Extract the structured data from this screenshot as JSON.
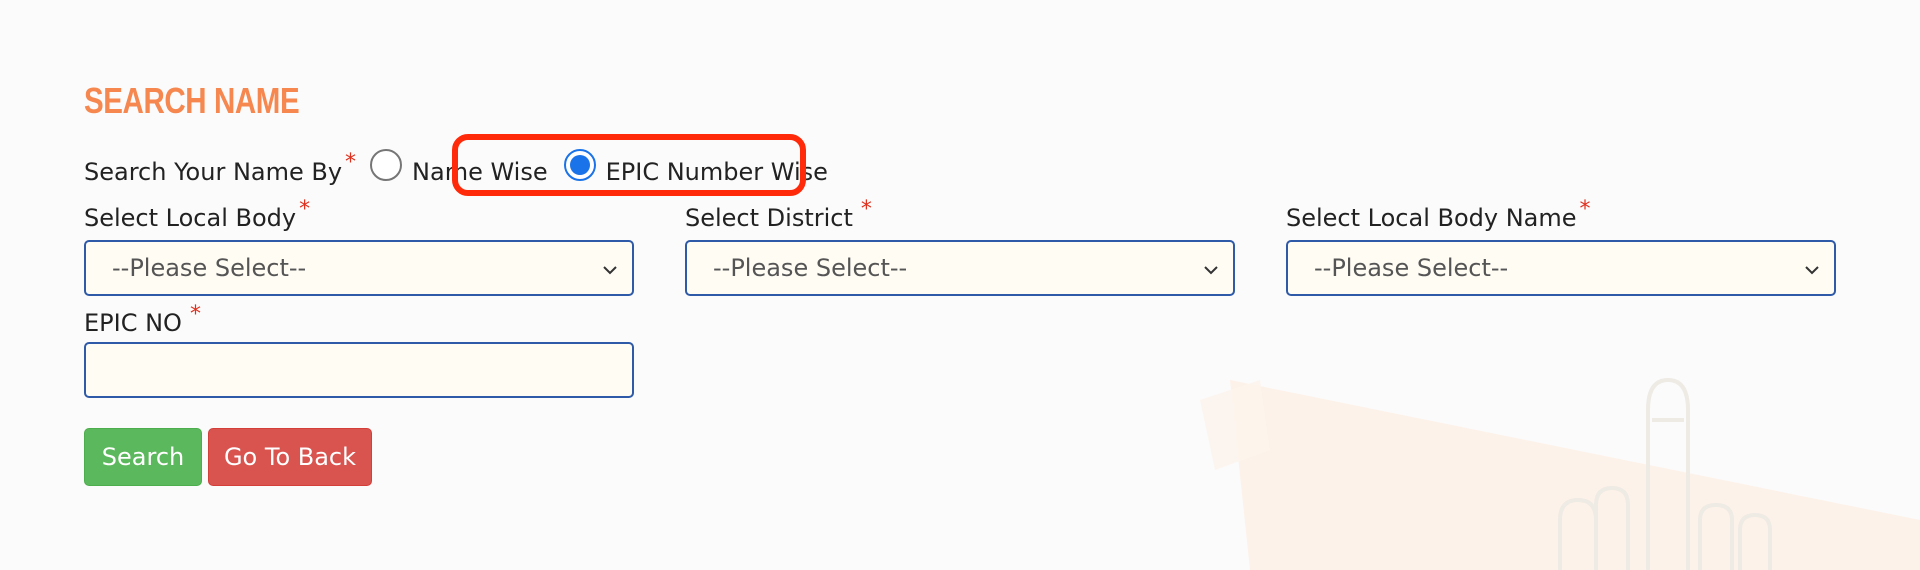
{
  "page": {
    "title": "SEARCH NAME"
  },
  "search_by": {
    "label": "Search Your Name By",
    "required_mark": "*",
    "options": [
      {
        "label": "Name Wise",
        "selected": false
      },
      {
        "label": "EPIC Number Wise",
        "selected": true
      }
    ]
  },
  "fields": {
    "local_body": {
      "label": "Select Local Body",
      "required_mark": "*",
      "value": "--Please Select--"
    },
    "district": {
      "label": "Select District",
      "required_mark": "*",
      "value": "--Please Select--"
    },
    "local_body_name": {
      "label": "Select Local Body Name",
      "required_mark": "*",
      "value": "--Please Select--"
    },
    "epic_no": {
      "label": "EPIC NO",
      "required_mark": "*",
      "value": ""
    }
  },
  "buttons": {
    "search": "Search",
    "back": "Go To Back"
  },
  "colors": {
    "title": "#f5874f",
    "required": "#e0301e",
    "highlight": "#ff2a0a",
    "search_button": "#5cb85c",
    "back_button": "#d9534f",
    "field_border": "#2e5aa8",
    "radio_selected": "#1a73e8"
  }
}
